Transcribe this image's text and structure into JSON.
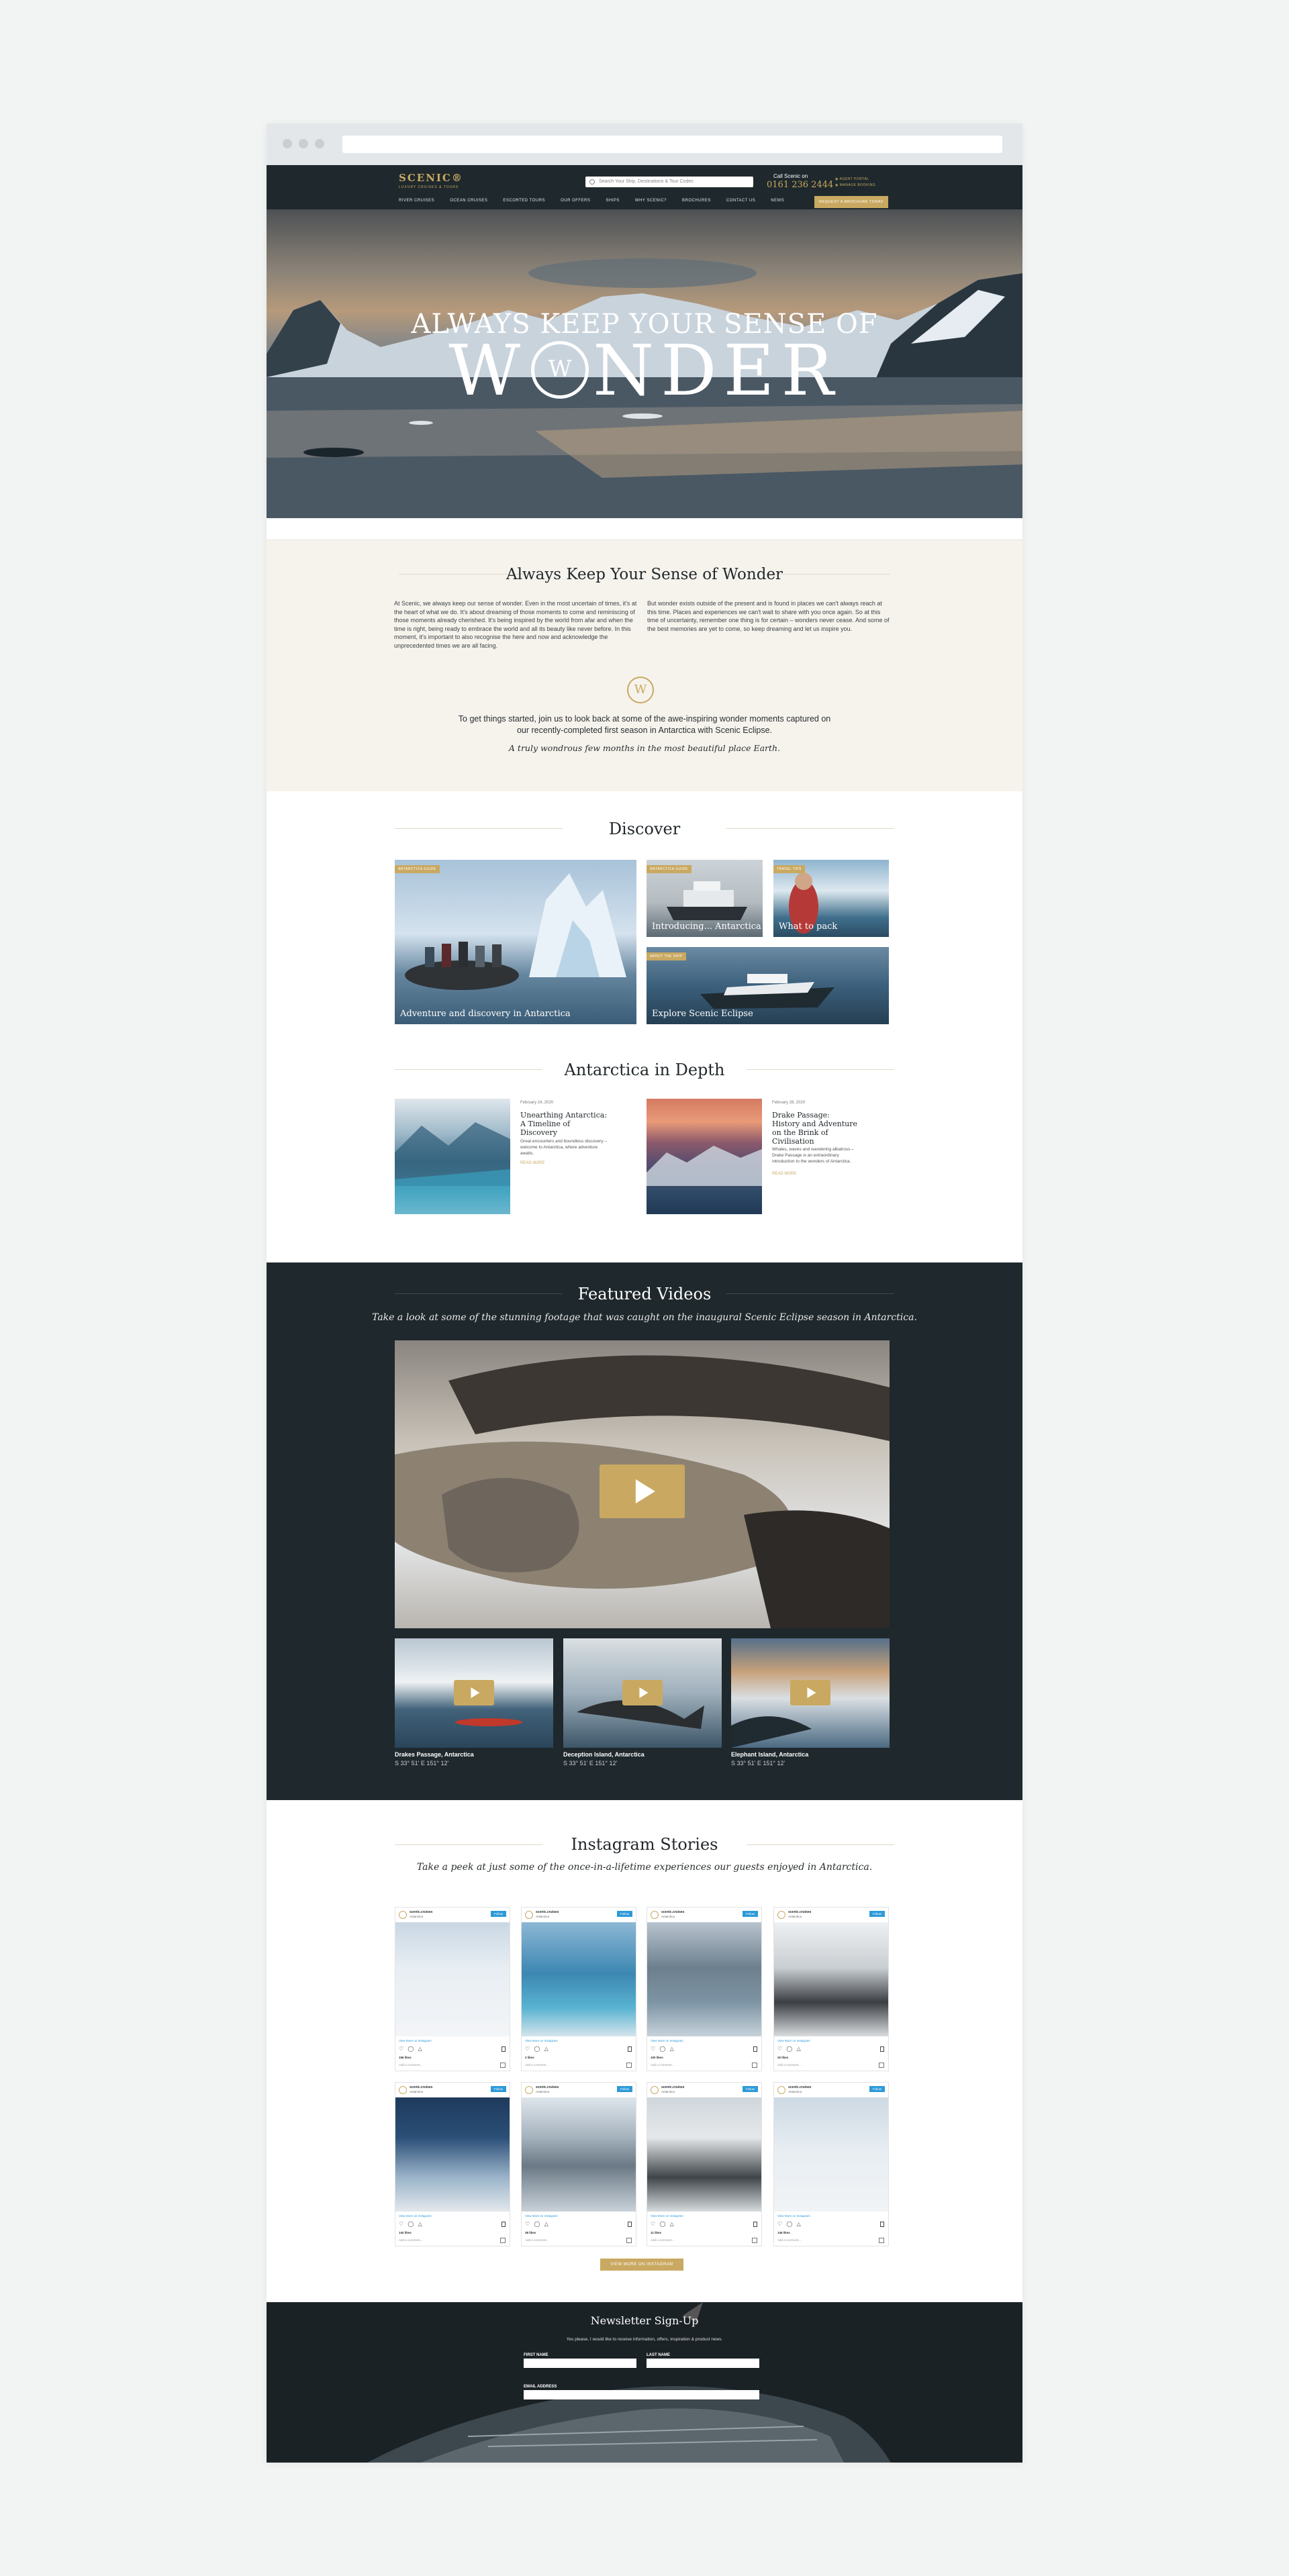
{
  "header": {
    "logo": "SCENIC®",
    "logo_sub": "LUXURY CRUISES & TOURS",
    "search_placeholder": "Search Your Ship, Destinations & Tour Codes",
    "call_label": "Call Scenic on",
    "phone": "0161 236 2444",
    "util_1": "AGENT PORTAL",
    "util_2": "MANAGE BOOKING",
    "nav": [
      "RIVER CRUISES",
      "OCEAN CRUISES",
      "ESCORTED TOURS",
      "OUR OFFERS",
      "SHIPS",
      "WHY SCENIC?",
      "BROCHURES",
      "CONTACT US",
      "NEWS"
    ],
    "cta": "REQUEST A BROCHURE TODAY"
  },
  "hero": {
    "line1": "ALWAYS KEEP YOUR SENSE OF",
    "line2_start": "W",
    "line2_end": "NDER"
  },
  "intro": {
    "title": "Always Keep Your Sense of Wonder",
    "col1": "At Scenic, we always keep our sense of wonder. Even in the most uncertain of times, it's at the heart of what we do. It's about dreaming of those moments to come and reminiscing of those moments already cherished. It's being inspired by the world from afar and when the time is right, being ready to embrace the world and all its beauty like never before. In this moment, it's important to also recognise the here and now and acknowledge the unprecedented times we are all facing.",
    "col2": "But wonder exists outside of the present and is found in places we can't always reach at this time. Places and experiences we can't wait to share with you once again. So at this time of uncertainty, remember one thing is for certain – wonders never cease. And some of the best memories are yet to come, so keep dreaming and let us inspire you.",
    "mark": "W",
    "lead": "To get things started, join us to look back at some of the awe-inspiring wonder moments captured on our recently-completed first season in Antarctica with Scenic Eclipse.",
    "tagline": "A truly wondrous few months in the most beautiful place Earth."
  },
  "discover": {
    "title": "Discover",
    "cards": [
      {
        "badge": "ANTARCTICA GUIDE",
        "caption": "Adventure and discovery in Antarctica"
      },
      {
        "badge": "ANTARCTICA GUIDE",
        "caption": "Introducing... Antarctica"
      },
      {
        "badge": "TRAVEL TIPS",
        "caption": "What to pack"
      },
      {
        "badge": "ABOUT THE SHIP",
        "caption": "Explore Scenic Eclipse"
      }
    ]
  },
  "depth": {
    "title": "Antarctica in Depth",
    "articles": [
      {
        "date": "February 24, 2020",
        "title": "Unearthing Antarctica: A Timeline of Discovery",
        "excerpt": "Great encounters and boundless discovery – welcome to Antarctica, where adventure awaits.",
        "more": "READ MORE"
      },
      {
        "date": "February 28, 2020",
        "title": "Drake Passage: History and Adventure on the Brink of Civilisation",
        "excerpt": "Whales, waves and wandering albatross – Drake Passage is an extraordinary introduction to the wonders of Antarctica.",
        "more": "READ MORE"
      }
    ]
  },
  "videos": {
    "title": "Featured Videos",
    "subtitle": "Take a look at some of the stunning footage that was caught on the inaugural Scenic Eclipse season in Antarctica.",
    "items": [
      {
        "title": "Drakes Passage, Antarctica",
        "coords": "S 33° 51' E 151° 12'"
      },
      {
        "title": "Deception Island, Antarctica",
        "coords": "S 33° 51' E 151° 12'"
      },
      {
        "title": "Elephant Island, Antarctica",
        "coords": "S 33° 51' E 151° 12'"
      }
    ]
  },
  "instagram": {
    "title": "Instagram Stories",
    "subtitle": "Take a peek at just some of the once-in-a-lifetime experiences our guests enjoyed in Antarctica.",
    "user": "scenic.cruises",
    "location": "Antarctica",
    "follow": "Follow",
    "view_more": "View More on Instagram",
    "icons": "♡ ◯ △",
    "add_comment": "Add a comment...",
    "likes": [
      "156 likes",
      "2 likes",
      "100 likes",
      "25 likes",
      "140 likes",
      "38 likes",
      "11 likes",
      "146 likes"
    ],
    "more_button": "VIEW MORE ON INSTAGRAM"
  },
  "newsletter": {
    "title": "Newsletter Sign-Up",
    "text": "Yes please, I would like to receive information, offers, inspiration & product news.",
    "first_name": "FIRST NAME",
    "last_name": "LAST NAME",
    "email": "EMAIL ADDRESS"
  }
}
